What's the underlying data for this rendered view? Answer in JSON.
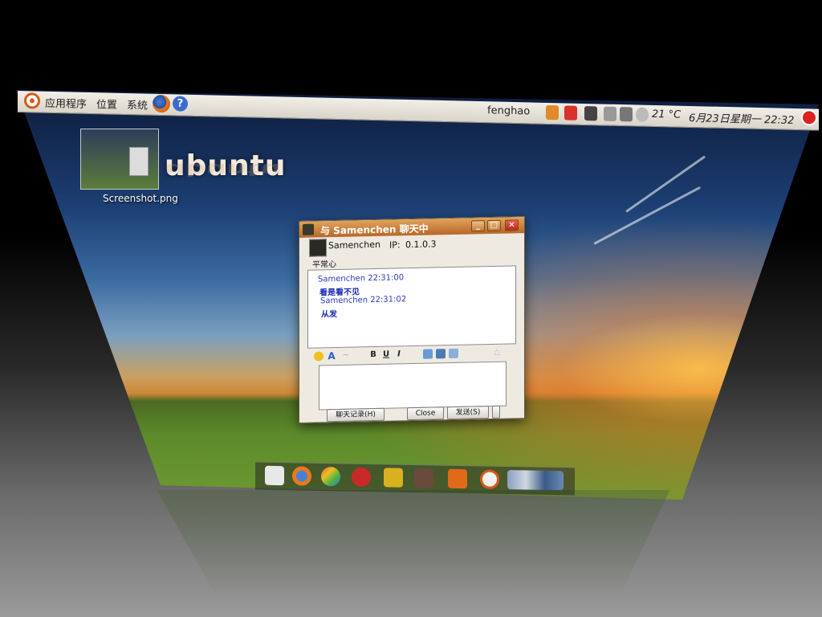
{
  "panel": {
    "menu_applications": "应用程序",
    "menu_places": "位置",
    "menu_system": "系统",
    "username": "fenghao",
    "weather": "21 °C",
    "datetime": "6月23日星期一 22:32"
  },
  "desktop": {
    "brand": "ubuntu",
    "icon_label": "Screenshot.png"
  },
  "chat_window": {
    "title": "与 Samenchen 聊天中",
    "buddy_name": "Samenchen",
    "ip_label": "IP:",
    "ip_value": "0.1.0.3",
    "signature": "平常心",
    "messages": [
      {
        "sender_time": "Samenchen 22:31:00",
        "text": "看是看不见"
      },
      {
        "sender_time": "Samenchen 22:31:02",
        "text": "从发"
      }
    ],
    "toolbar": {
      "bold": "B",
      "underline": "U",
      "italic": "I",
      "font": "A"
    },
    "buttons": {
      "history": "聊天记录(H)",
      "close": "Close",
      "send": "发送(S)"
    },
    "input_value": ""
  },
  "colors": {
    "panel_bg": "#e5e1d8",
    "titlebar": "#c87a36",
    "message_blue": "#1a2ab0"
  },
  "dock_icons": [
    "files-icon",
    "firefox-icon",
    "colors-icon",
    "record-icon",
    "tux-icon",
    "terminal-icon",
    "ubuntu-box-icon",
    "ubuntu-icon",
    "workspace-switcher-icon"
  ]
}
